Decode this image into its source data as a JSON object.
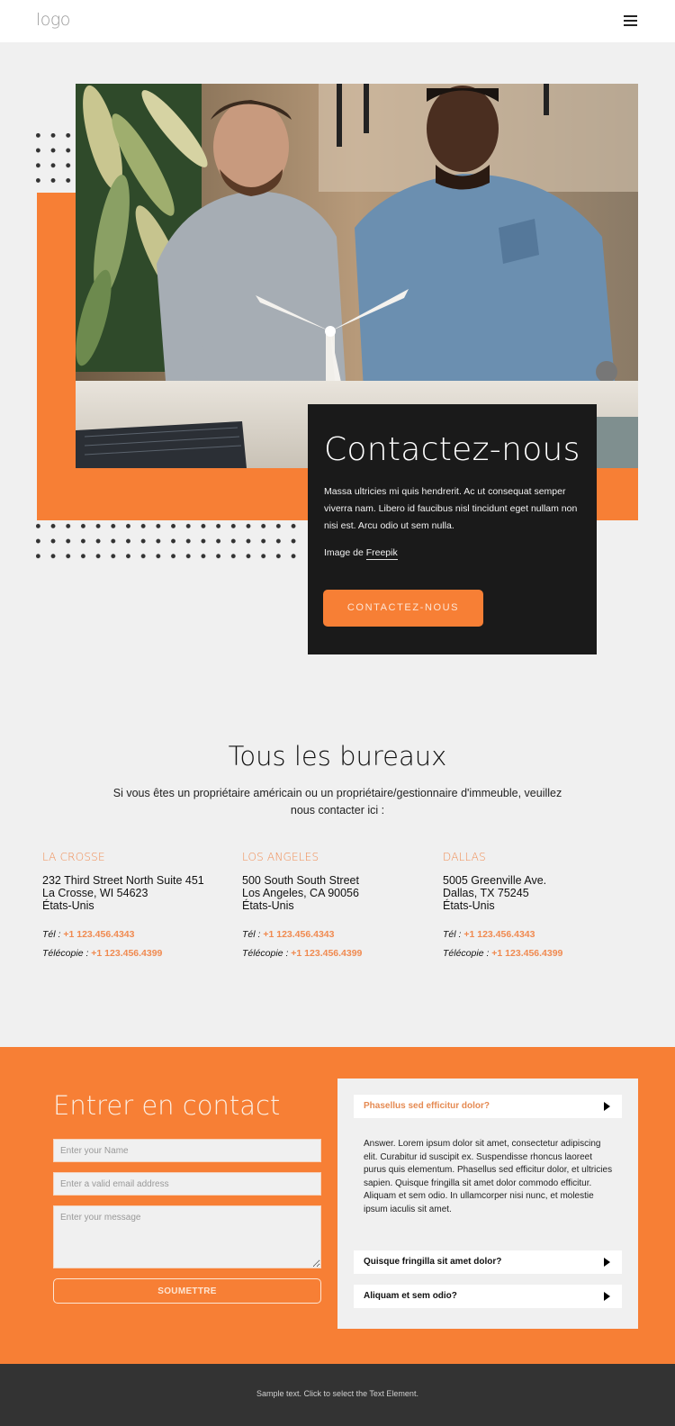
{
  "header": {
    "logo": "logo",
    "menu_icon": "hamburger-menu-icon"
  },
  "hero": {
    "image_alt": "Two men looking at a wind turbine model on a desk",
    "title": "Contactez-nous",
    "text": "Massa ultricies mi quis hendrerit. Ac ut consequat semper viverra nam. Libero id faucibus nisl tincidunt eget nullam non nisi est. Arcu odio ut sem nulla.",
    "credit_prefix": "Image de ",
    "credit_link": "Freepik",
    "button": "CONTACTEZ-NOUS"
  },
  "offices": {
    "title": "Tous les bureaux",
    "subtitle": "Si vous êtes un propriétaire américain ou un propriétaire/gestionnaire d'immeuble, veuillez nous contacter ici :",
    "tel_label": "Tél : ",
    "fax_label": "Télécopie : ",
    "items": [
      {
        "city": "LA CROSSE",
        "line1": "232 Third Street North Suite 451",
        "line2": "La Crosse, WI 54623",
        "line3": "États-Unis",
        "tel": "+1 123.456.4343",
        "fax": "+1 123.456.4399"
      },
      {
        "city": "LOS ANGELES",
        "line1": "500 South South Street",
        "line2": "Los Angeles, CA 90056",
        "line3": "États-Unis",
        "tel": "+1 123.456.4343",
        "fax": "+1 123.456.4399"
      },
      {
        "city": "DALLAS",
        "line1": "5005 Greenville Ave.",
        "line2": "Dallas, TX 75245",
        "line3": "États-Unis",
        "tel": "+1 123.456.4343",
        "fax": "+1 123.456.4399"
      }
    ]
  },
  "contact": {
    "title": "Entrer en contact",
    "name_placeholder": "Enter your Name",
    "email_placeholder": "Enter a valid email address",
    "message_placeholder": "Enter your message",
    "submit": "SOUMETTRE"
  },
  "faq": {
    "items": [
      {
        "question": "Phasellus sed efficitur dolor?",
        "expanded": true
      },
      {
        "question": "Quisque fringilla sit amet dolor?",
        "expanded": false
      },
      {
        "question": "Aliquam et sem odio?",
        "expanded": false
      }
    ],
    "answer": "Answer. Lorem ipsum dolor sit amet, consectetur adipiscing elit. Curabitur id suscipit ex. Suspendisse rhoncus laoreet purus quis elementum. Phasellus sed efficitur dolor, et ultricies sapien. Quisque fringilla sit amet dolor commodo efficitur. Aliquam et sem odio. In ullamcorper nisi nunc, et molestie ipsum iaculis sit amet."
  },
  "footer": {
    "text": "Sample text. Click to select the Text Element."
  },
  "colors": {
    "accent": "#f77f35",
    "dark_card": "#1a1a1a",
    "footer": "#333333",
    "background": "#f0f0f0"
  }
}
